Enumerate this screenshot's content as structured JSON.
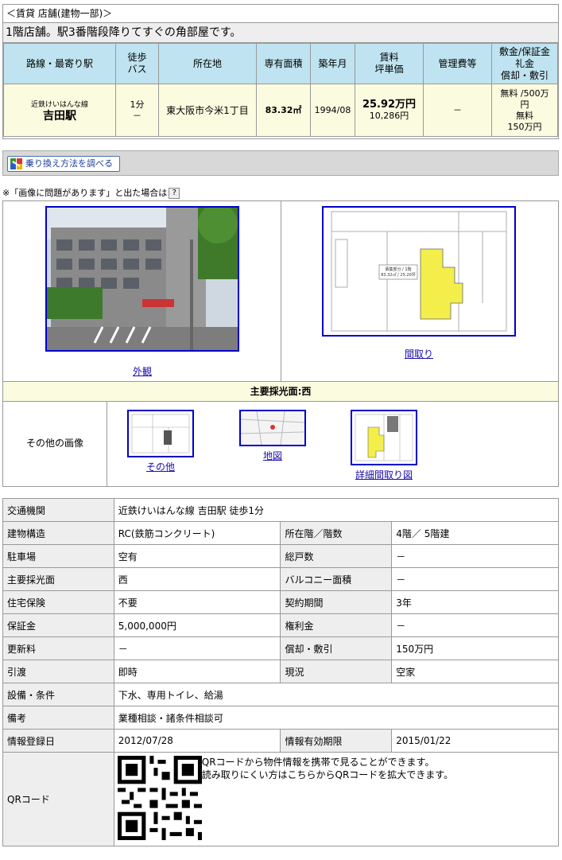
{
  "breadcrumb": "＜賃貸 店舗(建物一部)＞",
  "catch_copy": "1階店舗。駅3番階段降りてすぐの角部屋です。",
  "summary": {
    "headers": {
      "station": "路線・最寄り駅",
      "walk_line1": "徒歩",
      "walk_line2": "バス",
      "address": "所在地",
      "area": "専有面積",
      "built": "築年月",
      "rent_line1": "賃料",
      "rent_line2": "坪単価",
      "mgmt": "管理費等",
      "deposit_line1": "敷金/保証金",
      "deposit_line2": "礼金",
      "deposit_line3": "償却・敷引"
    },
    "row": {
      "line": "近鉄けいはんな線",
      "station": "吉田駅",
      "walk": "1分",
      "bus": "－",
      "address": "東大阪市今米1丁目",
      "area": "83.32㎡",
      "built": "1994/08",
      "rent": "25.92万円",
      "tsubo": "10,286円",
      "mgmt": "－",
      "deposit_line1": "無料 /500万",
      "deposit_line2": "円",
      "deposit_line3": "無料",
      "deposit_line4": "150万円"
    }
  },
  "route_button": "乗り換え方法を調べる",
  "image_note": "※「画像に問題があります」と出た場合は",
  "help_mark": "?",
  "images": {
    "exterior_label": "外観",
    "floorplan_label": "間取り",
    "floorplan_annotation_line1": "募集部分 / 1階",
    "floorplan_annotation_line2": "83.32㎡ / 25.20坪",
    "sun_direction": "主要採光面:西",
    "others_label": "その他の画像",
    "thumbs": [
      "その他",
      "地図",
      "詳細間取り図"
    ]
  },
  "details": {
    "transport": {
      "label": "交通機関",
      "value": "近鉄けいはんな線 吉田駅 徒歩1分"
    },
    "structure": {
      "label": "建物構造",
      "value": "RC(鉄筋コンクリート)"
    },
    "floor": {
      "label": "所在階／階数",
      "value": "4階／ 5階建"
    },
    "parking": {
      "label": "駐車場",
      "value": "空有"
    },
    "units": {
      "label": "総戸数",
      "value": "－"
    },
    "light": {
      "label": "主要採光面",
      "value": "西"
    },
    "balcony": {
      "label": "バルコニー面積",
      "value": "－"
    },
    "insurance": {
      "label": "住宅保険",
      "value": "不要"
    },
    "contract": {
      "label": "契約期間",
      "value": "3年"
    },
    "deposit": {
      "label": "保証金",
      "value": "5,000,000円"
    },
    "keymoney": {
      "label": "権利金",
      "value": "－"
    },
    "renewal": {
      "label": "更新料",
      "value": "－"
    },
    "amort": {
      "label": "償却・敷引",
      "value": "150万円"
    },
    "handover": {
      "label": "引渡",
      "value": "即時"
    },
    "status": {
      "label": "現況",
      "value": "空家"
    },
    "equipment": {
      "label": "設備・条件",
      "value": "下水、専用トイレ、給湯"
    },
    "remarks": {
      "label": "備考",
      "value": "業種相談・諸条件相談可"
    },
    "registered": {
      "label": "情報登録日",
      "value": "2012/07/28"
    },
    "expiry": {
      "label": "情報有効期限",
      "value": "2015/01/22"
    },
    "qr": {
      "label": "QRコード",
      "line1": "QRコードから物件情報を携帯で見ることができます。",
      "line2": "読み取りにくい方はこちらからQRコードを拡大できます。"
    }
  },
  "colors": {
    "header_bg": "#bfe3f0",
    "row_bg": "#fbfbe0",
    "link": "#1a0dab",
    "frame": "#0000cc"
  }
}
